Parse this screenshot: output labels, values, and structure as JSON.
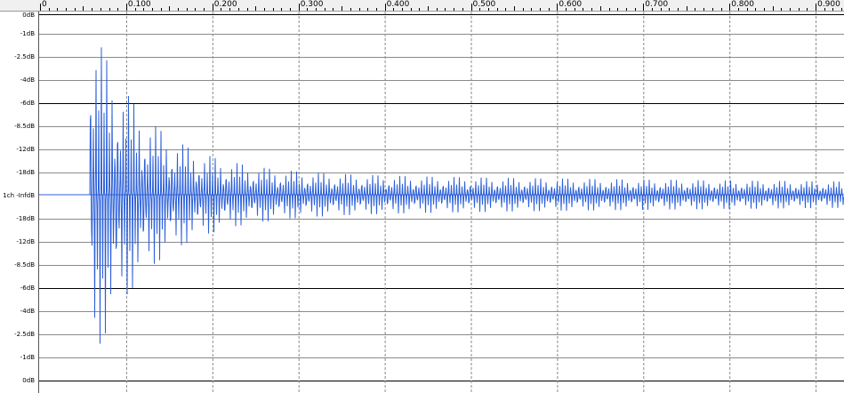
{
  "colors": {
    "waveform": "#2b5fd9",
    "center_line": "#2b5fd9",
    "grid_major": "#000000",
    "grid_minor": "#8a8a8a",
    "time_grid": "#8a8a8a"
  },
  "timeline": {
    "labels": [
      "0",
      "0.100",
      "0.200",
      "0.300",
      "0.400",
      "0.500",
      "0.600",
      "0.700",
      "0.800",
      "0.900"
    ]
  },
  "amplitude_ruler": {
    "labels": [
      "0dB",
      "-1dB",
      "-2.5dB",
      "-4dB",
      "-6dB",
      "-8.5dB",
      "-12dB",
      "-18dB",
      "1ch -InfdB",
      "-18dB",
      "-12dB",
      "-8.5dB",
      "-6dB",
      "-4dB",
      "-2.5dB",
      "-1dB",
      "0dB"
    ]
  }
}
